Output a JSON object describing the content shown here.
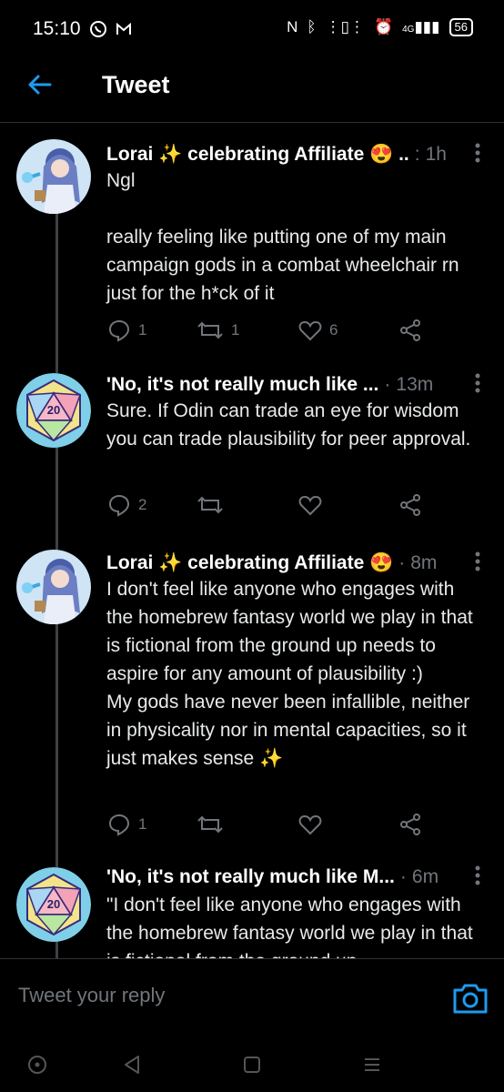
{
  "status_bar": {
    "time": "15:10",
    "left_icons": [
      "whatsapp-icon",
      "gmail-icon"
    ],
    "right_icons": [
      "nfc-icon",
      "bluetooth-icon",
      "vibrate-icon",
      "alarm-icon",
      "signal-4g-icon"
    ],
    "network": "4G",
    "battery": "56"
  },
  "header": {
    "title": "Tweet"
  },
  "colors": {
    "accent": "#1d9bf0",
    "background": "#000000",
    "muted": "#71767b",
    "divider": "#2f3336"
  },
  "tweets": [
    {
      "name": "Lorai ✨ celebrating Affiliate 😍 ..",
      "sep": ":",
      "time": "1h",
      "text": "Ngl\n\nreally feeling like putting one of my main campaign gods in a combat wheelchair rn just for the h*ck of it",
      "replies": "1",
      "retweets": "1",
      "likes": "6"
    },
    {
      "name": "'No, it's not really much like ...",
      "sep": "·",
      "time": "13m",
      "text": "Sure. If Odin can trade an eye for wisdom you can trade plausibility for peer approval.",
      "replies": "2",
      "retweets": "",
      "likes": ""
    },
    {
      "name": "Lorai ✨ celebrating Affiliate 😍",
      "sep": "·",
      "time": "8m",
      "text": "I don't feel like anyone who engages with the homebrew fantasy world we play in that is fictional from the ground up needs to aspire for any amount of plausibility :)\nMy gods have never been infallible, neither in physicality nor in mental capacities, so it just makes sense ✨",
      "replies": "1",
      "retweets": "",
      "likes": ""
    },
    {
      "name": "'No, it's not really much like M...",
      "sep": "·",
      "time": "6m",
      "text": "\"I don't feel like anyone who engages with the homebrew fantasy world we play in that is fictional from the ground up",
      "replies": "",
      "retweets": "",
      "likes": ""
    }
  ],
  "reply": {
    "placeholder": "Tweet your reply"
  },
  "navbar": {
    "buttons": [
      "assistant-icon",
      "back-triangle-icon",
      "home-square-icon",
      "recents-menu-icon"
    ]
  }
}
